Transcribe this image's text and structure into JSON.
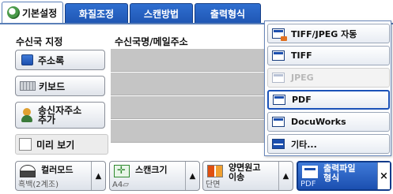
{
  "tabs": [
    {
      "label": "기본설정",
      "active": true
    },
    {
      "label": "화질조정",
      "active": false
    },
    {
      "label": "스캔방법",
      "active": false
    },
    {
      "label": "출력형식",
      "active": false
    }
  ],
  "headers": {
    "recipient": "수신국 지정",
    "address": "수신국명/메일주소"
  },
  "buttons": {
    "address_book": "주소록",
    "keyboard": "키보드",
    "add_sender": "송신자주소\n추가"
  },
  "preview": {
    "label": "미리 보기",
    "checked": false
  },
  "format_menu": {
    "items": [
      {
        "label": "TIFF/JPEG 자동",
        "icon": "tiff-jpeg-icon",
        "disabled": false,
        "selected": false
      },
      {
        "label": "TIFF",
        "icon": "tiff-icon",
        "disabled": false,
        "selected": false
      },
      {
        "label": "JPEG",
        "icon": "jpeg-icon",
        "disabled": true,
        "selected": false
      },
      {
        "label": "PDF",
        "icon": "pdf-icon",
        "disabled": false,
        "selected": true
      },
      {
        "label": "DocuWorks",
        "icon": "docuworks-icon",
        "disabled": false,
        "selected": false
      },
      {
        "label": "기타...",
        "icon": "other-format-icon",
        "disabled": false,
        "selected": false
      }
    ]
  },
  "bottom": {
    "color_mode": {
      "title": "컬러모드",
      "value": "흑백(2계조)"
    },
    "scan_size": {
      "title": "스캔크기",
      "value": "A4▱"
    },
    "duplex": {
      "title": "양면원고\n이송",
      "value": "단면"
    },
    "output_format": {
      "title": "출력파일\n형식",
      "value": "PDF"
    }
  },
  "colors": {
    "tab_blue": "#1f56b3",
    "selected_border": "#1b52b8",
    "gray_row": "#c5c5c5"
  }
}
